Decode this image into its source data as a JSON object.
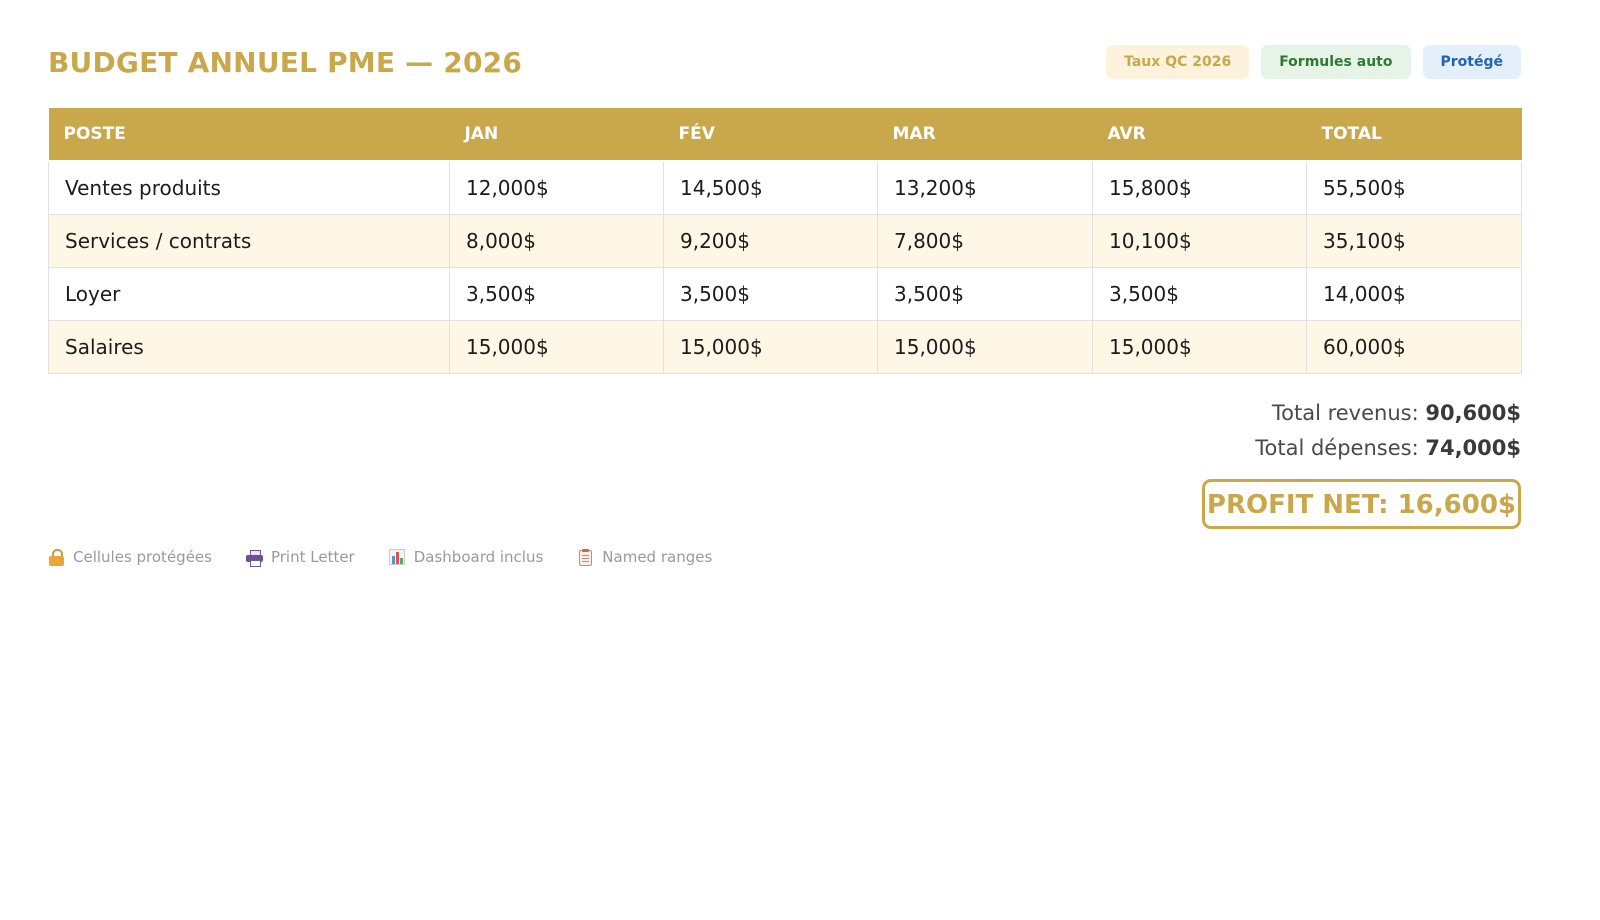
{
  "header": {
    "title": "BUDGET ANNUEL PME — 2026",
    "badges": [
      "Taux QC 2026",
      "Formules auto",
      "Protégé"
    ]
  },
  "table": {
    "columns": [
      "POSTE",
      "JAN",
      "FÉV",
      "MAR",
      "AVR",
      "TOTAL"
    ],
    "rows": [
      [
        "Ventes produits",
        "12,000$",
        "14,500$",
        "13,200$",
        "15,800$",
        "55,500$"
      ],
      [
        "Services / contrats",
        "8,000$",
        "9,200$",
        "7,800$",
        "10,100$",
        "35,100$"
      ],
      [
        "Loyer",
        "3,500$",
        "3,500$",
        "3,500$",
        "3,500$",
        "14,000$"
      ],
      [
        "Salaires",
        "15,000$",
        "15,000$",
        "15,000$",
        "15,000$",
        "60,000$"
      ]
    ]
  },
  "summary": {
    "revenue_label": "Total revenus:",
    "revenue_value": "90,600$",
    "expenses_label": "Total dépenses:",
    "expenses_value": "74,000$",
    "profit_text": "PROFIT NET: 16,600$"
  },
  "footer": {
    "items": [
      {
        "icon": "lock-icon",
        "label": "Cellules protégées"
      },
      {
        "icon": "printer-icon",
        "label": "Print Letter"
      },
      {
        "icon": "bar-chart-icon",
        "label": "Dashboard inclus"
      },
      {
        "icon": "clipboard-icon",
        "label": "Named ranges"
      }
    ]
  },
  "colors": {
    "accent_gold": "#c8a84a",
    "row_alt": "#fef7e6",
    "badge_green": "#2f7a32",
    "badge_blue": "#1f64b3"
  }
}
